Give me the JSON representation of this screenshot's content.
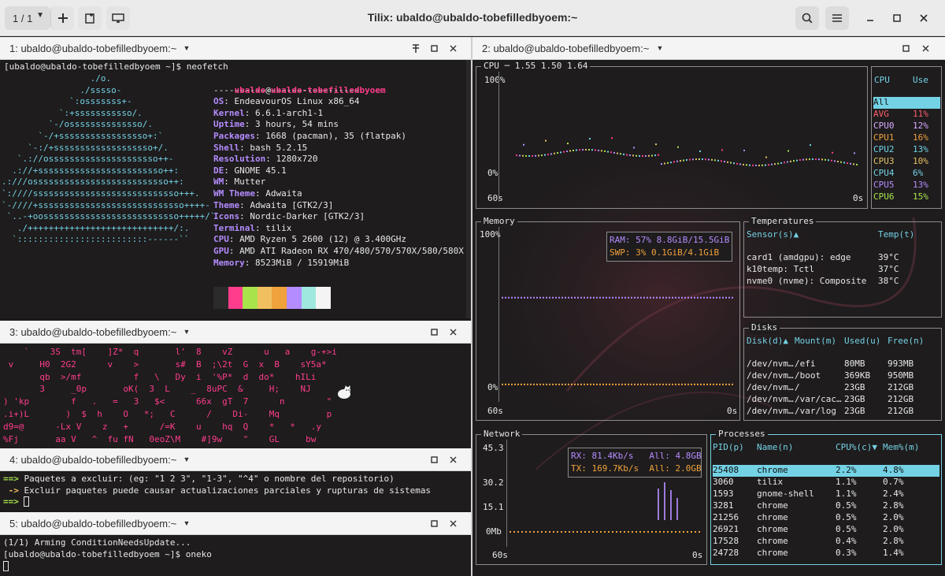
{
  "window": {
    "title": "Tilix: ubaldo@ubaldo-tobefilledbyoem:~",
    "session_selector": "1 / 1"
  },
  "colors": {
    "accent_pink": "#ff3d8c",
    "accent_purple": "#b48cff",
    "accent_cyan": "#74d2e5",
    "header_bg": "#ebebeb",
    "terminal_bg": "#1e1c1d"
  },
  "icons": {
    "add": "plus-icon",
    "side": "terminal-add-icon",
    "notify": "window-icon",
    "search": "search-icon",
    "menu": "hamburger-menu-icon",
    "min": "minimize-icon",
    "max": "maximize-icon",
    "close": "close-icon"
  },
  "pane1": {
    "title": "1: ubaldo@ubaldo-tobefilledbyoem:~",
    "prompt": "[ubaldo@ubaldo-tobefilledbyoem ~]$ neofetch",
    "logo": [
      "                 ./o.",
      "               ./sssso-",
      "             `:osssssss+-",
      "           `:+sssssssssso/.",
      "         `-/ossssssssssssso/.",
      "       `-/+sssssssssssssssso+:`",
      "     `-:/+sssssssssssssssssso+/.",
      "   `.://osssssssssssssssssssso++-",
      "  .://+ssssssssssssssssssssssso++:",
      ".:///ossssssssssssssssssssssssso++:",
      "`:////ssssssssssssssssssssssssssso+++.",
      "`-////+ssssssssssssssssssssssssssso++++-",
      " `..-+oossssssssssssssssssssssssso+++++/`",
      "   ./++++++++++++++++++++++++++++/:.",
      "  `:::::::::::::::::::::::::------``"
    ],
    "user": "ubaldo",
    "at": "@",
    "host": "ubaldo-tobefilledbyoem",
    "separator": "----------------------------",
    "info": [
      {
        "k": "OS",
        "v": "EndeavourOS Linux x86_64"
      },
      {
        "k": "Kernel",
        "v": "6.6.1-arch1-1"
      },
      {
        "k": "Uptime",
        "v": "3 hours, 54 mins"
      },
      {
        "k": "Packages",
        "v": "1668 (pacman), 35 (flatpak)"
      },
      {
        "k": "Shell",
        "v": "bash 5.2.15"
      },
      {
        "k": "Resolution",
        "v": "1280x720"
      },
      {
        "k": "DE",
        "v": "GNOME 45.1"
      },
      {
        "k": "WM",
        "v": "Mutter"
      },
      {
        "k": "WM Theme",
        "v": "Adwaita"
      },
      {
        "k": "Theme",
        "v": "Adwaita [GTK2/3]"
      },
      {
        "k": "Icons",
        "v": "Nordic-Darker [GTK2/3]"
      },
      {
        "k": "Terminal",
        "v": "tilix"
      },
      {
        "k": "CPU",
        "v": "AMD Ryzen 5 2600 (12) @ 3.400GHz"
      },
      {
        "k": "GPU",
        "v": "AMD ATI Radeon RX 470/480/570/570X/580/580X"
      },
      {
        "k": "Memory",
        "v": "8523MiB / 15919MiB"
      }
    ],
    "palette": [
      "#2b2b2b",
      "#ff3d8c",
      "#a9e34b",
      "#f0c060",
      "#f0a23c",
      "#b48cff",
      "#9fe8e0",
      "#f4f4f4"
    ]
  },
  "pane3": {
    "title": "3: ubaldo@ubaldo-tobefilledbyoem:~",
    "rain": [
      "    `    3S  tm[    ]Z*  q       l'  8    vZ      u   a    g-+>i",
      " v     H0  2G2      v    >       s#  B  ;\\2t  G  x  B    sY5a*",
      "       qb  >/mf          f   \\   Dy  i  '%P*  d  do*    hILi",
      "       3     _0p       oK(  3  L    _  8uPC  &     H;    NJ",
      ") 'kp        f   .   =   3   $<      66x  gT  7      n        \"",
      ".i+)L       )  $  h    O   *;   C      /    Di-    Mq         p",
      "d9=@      -Lx V    z   +      /=K    u    hq  Q    *   *   .y",
      "%Fj       aa V   ^  fu fN   0eoZ\\M    #]9w    \"    GL     bw"
    ]
  },
  "pane4": {
    "title": "4: ubaldo@ubaldo-tobefilledbyoem:~",
    "lines": [
      {
        "p": "==> ",
        "t": "Paquetes a excluir: (eg: \"1 2 3\", \"1-3\", \"^4\" o nombre del repositorio)"
      },
      {
        "p": " -> ",
        "t": "Excluir paquetes puede causar actualizaciones parciales y rupturas de sistemas"
      },
      {
        "p": "==> ",
        "t": ""
      }
    ]
  },
  "pane5": {
    "title": "5: ubaldo@ubaldo-tobefilledbyoem:~",
    "lines": [
      "(1/1) Arming ConditionNeedsUpdate...",
      "[ubaldo@ubaldo-tobefilledbyoem ~]$ oneko"
    ]
  },
  "pane2": {
    "title": "2: ubaldo@ubaldo-tobefilledbyoem:~",
    "cpu": {
      "label": "CPU",
      "load": "1.55 1.50 1.64",
      "y_top": "100%",
      "y_bottom": "0%",
      "x_left": "60s",
      "x_right": "0s",
      "col_cpu": "CPU",
      "col_use": "Use",
      "rows": [
        {
          "n": "All",
          "v": ""
        },
        {
          "n": "AVG",
          "v": "11%"
        },
        {
          "n": "CPU0",
          "v": "12%"
        },
        {
          "n": "CPU1",
          "v": "16%"
        },
        {
          "n": "CPU2",
          "v": "13%"
        },
        {
          "n": "CPU3",
          "v": "10%"
        },
        {
          "n": "CPU4",
          "v": "6%"
        },
        {
          "n": "CPU5",
          "v": "13%"
        },
        {
          "n": "CPU6",
          "v": "15%"
        }
      ]
    },
    "memory": {
      "label": "Memory",
      "y_top": "100%",
      "y_bottom": "0%",
      "x_left": "60s",
      "x_right": "0s",
      "ram_label": "RAM:",
      "ram_pct": "57%",
      "ram_val": "8.8GiB/15.5GiB",
      "swp_label": "SWP:",
      "swp_pct": "3%",
      "swp_val": "0.1GiB/4.1GiB",
      "ram_fraction": 0.57,
      "swp_fraction": 0.03
    },
    "temps": {
      "label": "Temperatures",
      "col_sensor": "Sensor(s)▲",
      "col_temp": "Temp(t)",
      "rows": [
        {
          "s": "card1 (amdgpu): edge",
          "t": "39°C"
        },
        {
          "s": "k10temp: Tctl",
          "t": "37°C"
        },
        {
          "s": "nvme0 (nvme): Composite",
          "t": "38°C"
        }
      ]
    },
    "disks": {
      "label": "Disks",
      "cols": [
        "Disk(d)▲",
        "Mount(m)",
        "Used(u)",
        "Free(n)"
      ],
      "rows": [
        [
          "/dev/nvm…",
          "/efi",
          "80MB",
          "993MB"
        ],
        [
          "/dev/nvm…",
          "/boot",
          "369KB",
          "950MB"
        ],
        [
          "/dev/nvm…",
          "/",
          "23GB",
          "212GB"
        ],
        [
          "/dev/nvm…",
          "/var/cac…",
          "23GB",
          "212GB"
        ],
        [
          "/dev/nvm…",
          "/var/log",
          "23GB",
          "212GB"
        ]
      ]
    },
    "network": {
      "label": "Network",
      "y_ticks": [
        "45.3",
        "30.2",
        "15.1",
        "0Mb"
      ],
      "x_left": "60s",
      "x_right": "0s",
      "rx_label": "RX:",
      "rx_rate": "81.4Kb/s",
      "rx_all": "All: 4.8GB",
      "tx_label": "TX:",
      "tx_rate": "169.7Kb/s",
      "tx_all": "All: 2.0GB"
    },
    "processes": {
      "label": "Processes",
      "cols": [
        "PID(p)",
        "Name(n)",
        "CPU%(c)▼",
        "Mem%(m)"
      ],
      "rows": [
        [
          "25408",
          "chrome",
          "2.2%",
          "4.8%"
        ],
        [
          "3060",
          "tilix",
          "1.1%",
          "0.7%"
        ],
        [
          "1593",
          "gnome-shell",
          "1.1%",
          "2.4%"
        ],
        [
          "3281",
          "chrome",
          "0.5%",
          "2.8%"
        ],
        [
          "21256",
          "chrome",
          "0.5%",
          "2.0%"
        ],
        [
          "26921",
          "chrome",
          "0.5%",
          "2.0%"
        ],
        [
          "17528",
          "chrome",
          "0.4%",
          "2.8%"
        ],
        [
          "24728",
          "chrome",
          "0.3%",
          "1.4%"
        ]
      ]
    }
  }
}
